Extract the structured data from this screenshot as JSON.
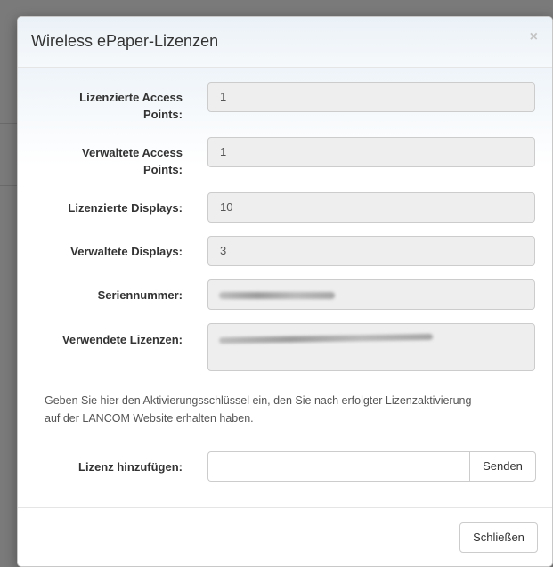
{
  "modal": {
    "title": "Wireless ePaper-Lizenzen",
    "close_glyph": "×"
  },
  "fields": [
    {
      "label": "Lizenzierte Access Points:",
      "value": "1"
    },
    {
      "label": "Verwaltete Access Points:",
      "value": "1"
    },
    {
      "label": "Lizenzierte Displays:",
      "value": "10"
    },
    {
      "label": "Verwaltete Displays:",
      "value": "3"
    },
    {
      "label": "Seriennummer:",
      "value": ""
    },
    {
      "label": "Verwendete Lizenzen:",
      "value": ""
    }
  ],
  "help_text": "Geben Sie hier den Aktivierungsschlüssel ein, den Sie nach erfolgter Lizenzaktivierung auf der LANCOM Website erhalten haben.",
  "add_license": {
    "label": "Lizenz hinzufügen:",
    "value": "",
    "send_label": "Senden"
  },
  "footer": {
    "close_label": "Schließen"
  }
}
